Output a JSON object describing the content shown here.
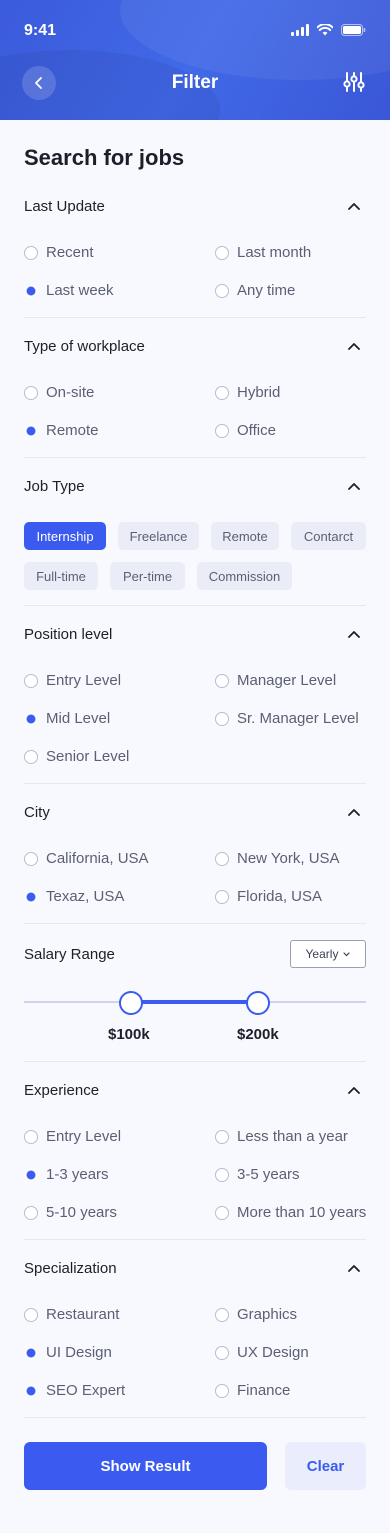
{
  "status_bar": {
    "time": "9:41"
  },
  "header": {
    "title": "Filter"
  },
  "page_title": "Search for jobs",
  "last_update": {
    "title": "Last Update",
    "options": [
      {
        "label": "Recent",
        "selected": false
      },
      {
        "label": "Last month",
        "selected": false
      },
      {
        "label": "Last week",
        "selected": true
      },
      {
        "label": "Any time",
        "selected": false
      }
    ]
  },
  "workplace": {
    "title": "Type of workplace",
    "options": [
      {
        "label": "On-site",
        "selected": false
      },
      {
        "label": "Hybrid",
        "selected": false
      },
      {
        "label": "Remote",
        "selected": true
      },
      {
        "label": "Office",
        "selected": false
      }
    ]
  },
  "job_type": {
    "title": "Job Type",
    "chips": [
      {
        "label": "Internship",
        "selected": true
      },
      {
        "label": "Freelance",
        "selected": false
      },
      {
        "label": "Remote",
        "selected": false
      },
      {
        "label": "Contarct",
        "selected": false
      },
      {
        "label": "Full-time",
        "selected": false
      },
      {
        "label": "Per-time",
        "selected": false
      },
      {
        "label": "Commission",
        "selected": false
      }
    ]
  },
  "position": {
    "title": "Position level",
    "options": [
      {
        "label": "Entry Level",
        "selected": false
      },
      {
        "label": "Manager Level",
        "selected": false
      },
      {
        "label": "Mid Level",
        "selected": true
      },
      {
        "label": "Sr. Manager Level",
        "selected": false
      },
      {
        "label": "Senior Level",
        "selected": false
      }
    ]
  },
  "city": {
    "title": "City",
    "options": [
      {
        "label": "California, USA",
        "selected": false
      },
      {
        "label": "New York, USA",
        "selected": false
      },
      {
        "label": "Texaz, USA",
        "selected": true
      },
      {
        "label": "Florida, USA",
        "selected": false
      }
    ]
  },
  "salary": {
    "title": "Salary Range",
    "period": "Yearly",
    "min_label": "$100k",
    "max_label": "$200k"
  },
  "experience": {
    "title": "Experience",
    "options": [
      {
        "label": "Entry Level",
        "selected": false
      },
      {
        "label": "Less than a year",
        "selected": false
      },
      {
        "label": "1-3 years",
        "selected": true
      },
      {
        "label": "3-5 years",
        "selected": false
      },
      {
        "label": "5-10 years",
        "selected": false
      },
      {
        "label": "More than 10 years",
        "selected": false
      }
    ]
  },
  "specialization": {
    "title": "Specialization",
    "options": [
      {
        "label": "Restaurant",
        "selected": false
      },
      {
        "label": "Graphics",
        "selected": false
      },
      {
        "label": "UI Design",
        "selected": true
      },
      {
        "label": "UX Design",
        "selected": false
      },
      {
        "label": "SEO Expert",
        "selected": true
      },
      {
        "label": "Finance",
        "selected": false
      }
    ]
  },
  "actions": {
    "primary": "Show Result",
    "secondary": "Clear"
  },
  "colors": {
    "accent": "#3b5bf0",
    "header": "#3b5bdb",
    "background": "#f8f9fe"
  }
}
